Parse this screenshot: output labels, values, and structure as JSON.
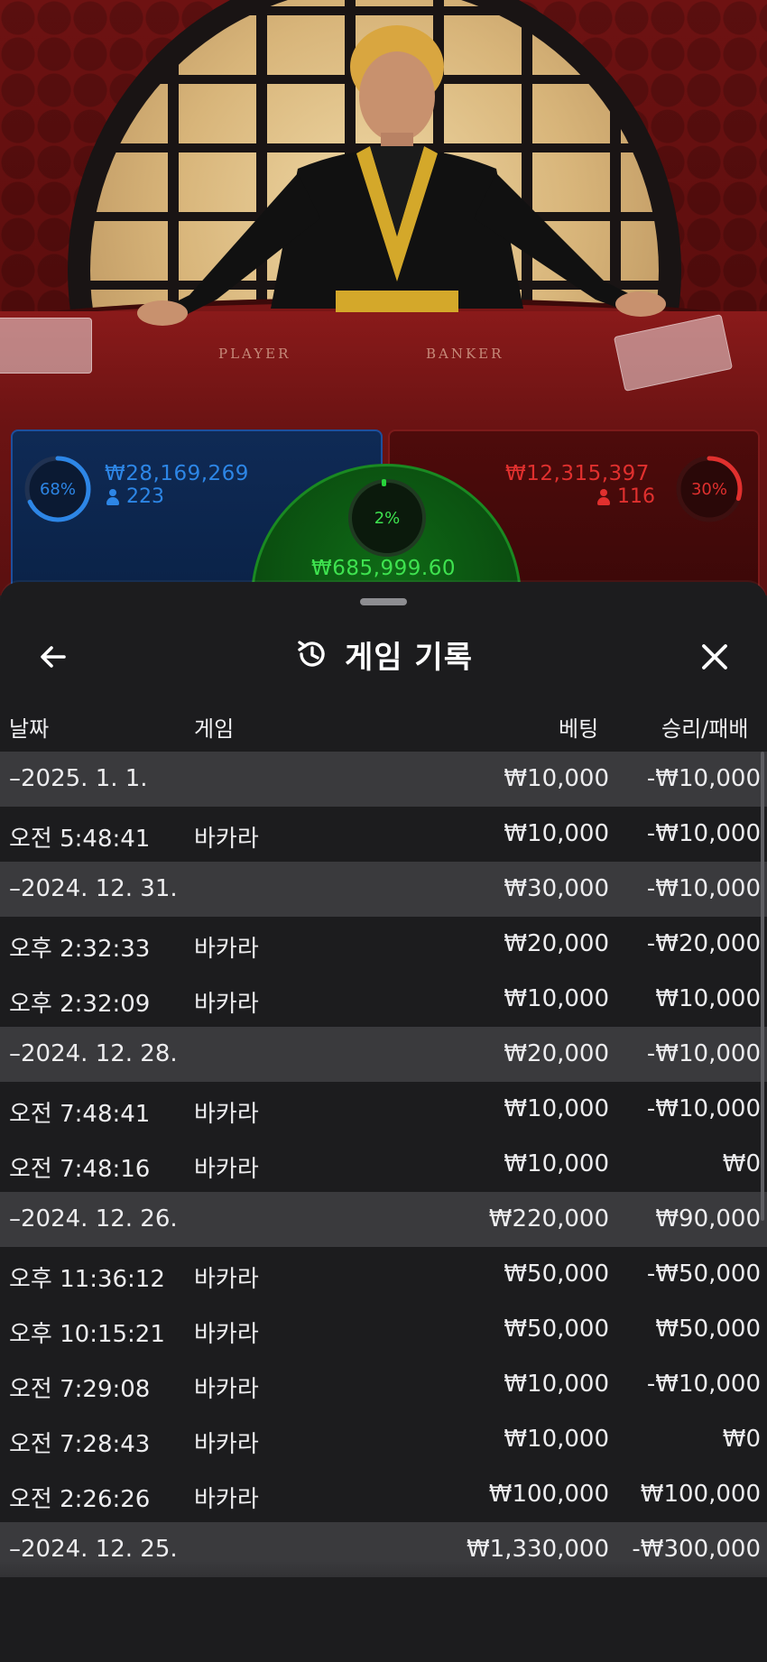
{
  "table": {
    "player_label": "PLAYER",
    "banker_label": "BANKER"
  },
  "bets": {
    "player": {
      "percent": "68%",
      "percent_value": 0.68,
      "amount": "₩28,169,269",
      "players": "223",
      "color": "#2d86e6"
    },
    "banker": {
      "percent": "30%",
      "percent_value": 0.3,
      "amount": "₩12,315,397",
      "players": "116",
      "color": "#e0302e"
    },
    "tie": {
      "percent": "2%",
      "percent_value": 0.02,
      "amount": "₩685,999.60",
      "color": "#3ee24f"
    }
  },
  "history": {
    "title": "게임 기록",
    "title_icon": "history-icon",
    "back_icon": "arrow-left-icon",
    "close_icon": "close-icon",
    "columns": {
      "date": "날짜",
      "game": "게임",
      "bet": "베팅",
      "result": "승리/패배"
    },
    "rows": [
      {
        "type": "date",
        "time": "–2025. 1. 1.",
        "game": "",
        "bet": "₩10,000",
        "result": "-₩10,000"
      },
      {
        "type": "item",
        "time": "오전 5:48:41",
        "game": "바카라",
        "bet": "₩10,000",
        "result": "-₩10,000"
      },
      {
        "type": "date",
        "time": "–2024. 12. 31.",
        "game": "",
        "bet": "₩30,000",
        "result": "-₩10,000"
      },
      {
        "type": "item",
        "time": "오후 2:32:33",
        "game": "바카라",
        "bet": "₩20,000",
        "result": "-₩20,000"
      },
      {
        "type": "item",
        "time": "오후 2:32:09",
        "game": "바카라",
        "bet": "₩10,000",
        "result": "₩10,000"
      },
      {
        "type": "date",
        "time": "–2024. 12. 28.",
        "game": "",
        "bet": "₩20,000",
        "result": "-₩10,000"
      },
      {
        "type": "item",
        "time": "오전 7:48:41",
        "game": "바카라",
        "bet": "₩10,000",
        "result": "-₩10,000"
      },
      {
        "type": "item",
        "time": "오전 7:48:16",
        "game": "바카라",
        "bet": "₩10,000",
        "result": "₩0"
      },
      {
        "type": "date",
        "time": "–2024. 12. 26.",
        "game": "",
        "bet": "₩220,000",
        "result": "₩90,000"
      },
      {
        "type": "item",
        "time": "오후 11:36:12",
        "game": "바카라",
        "bet": "₩50,000",
        "result": "-₩50,000"
      },
      {
        "type": "item",
        "time": "오후 10:15:21",
        "game": "바카라",
        "bet": "₩50,000",
        "result": "₩50,000"
      },
      {
        "type": "item",
        "time": "오전 7:29:08",
        "game": "바카라",
        "bet": "₩10,000",
        "result": "-₩10,000"
      },
      {
        "type": "item",
        "time": "오전 7:28:43",
        "game": "바카라",
        "bet": "₩10,000",
        "result": "₩0"
      },
      {
        "type": "item",
        "time": "오전 2:26:26",
        "game": "바카라",
        "bet": "₩100,000",
        "result": "₩100,000"
      },
      {
        "type": "date",
        "time": "–2024. 12. 25.",
        "game": "",
        "bet": "₩1,330,000",
        "result": "-₩300,000"
      }
    ]
  }
}
